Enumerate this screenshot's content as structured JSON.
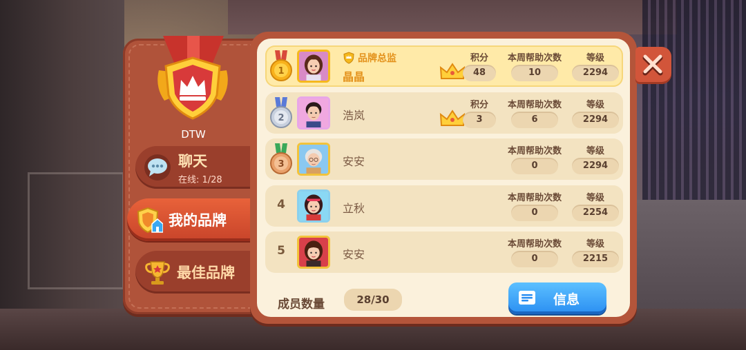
{
  "team": {
    "name": "DTW"
  },
  "side_menu": {
    "chat": {
      "label": "聊天",
      "online_text": "在线: 1/28"
    },
    "my_brand": {
      "label": "我的品牌"
    },
    "best_brand": {
      "label": "最佳品牌"
    }
  },
  "columns": {
    "points": "积分",
    "weekly_help": "本周帮助次数",
    "level": "等级"
  },
  "members": [
    {
      "rank": "1",
      "name": "晶晶",
      "title": "品牌总监",
      "points": "48",
      "weekly_help": "10",
      "level": "2294"
    },
    {
      "rank": "2",
      "name": "浩岚",
      "points": "3",
      "weekly_help": "6",
      "level": "2294"
    },
    {
      "rank": "3",
      "name": "安安",
      "weekly_help": "0",
      "level": "2294"
    },
    {
      "rank": "4",
      "name": "立秋",
      "weekly_help": "0",
      "level": "2254"
    },
    {
      "rank": "5",
      "name": "安安",
      "weekly_help": "0",
      "level": "2215"
    }
  ],
  "footer": {
    "member_count_label": "成员数量",
    "member_count": "28/30",
    "info_button": "信息"
  },
  "icons": {
    "close": "close-icon",
    "chat": "chat-bubble-icon",
    "my_brand": "shield-home-icon",
    "best_brand": "trophy-icon",
    "info": "document-icon",
    "team_badge": "crown-shield-icon"
  },
  "colors": {
    "panel_brown": "#b4553a",
    "row_highlight": "#ffeaa8",
    "row_bg": "#f3e3c1",
    "info_blue": "#2a8ef2",
    "title_orange": "#e3921c"
  }
}
